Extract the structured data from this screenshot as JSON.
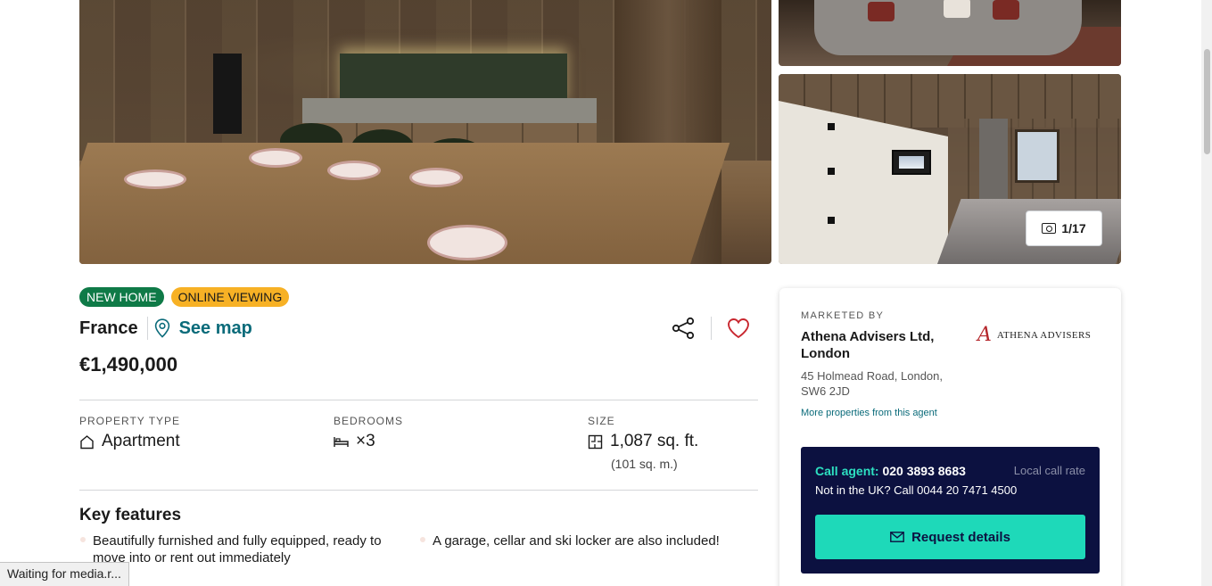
{
  "gallery": {
    "photo_counter": "1/17"
  },
  "listing": {
    "badges": [
      "NEW HOME",
      "ONLINE VIEWING"
    ],
    "country": "France",
    "see_map": "See map",
    "price": "€1,490,000"
  },
  "stats": {
    "property_type": {
      "label": "PROPERTY TYPE",
      "value": "Apartment"
    },
    "bedrooms": {
      "label": "BEDROOMS",
      "value": "×3"
    },
    "size": {
      "label": "SIZE",
      "value": "1,087 sq. ft.",
      "sub": "(101 sq. m.)"
    }
  },
  "key_features": {
    "title": "Key features",
    "items": [
      "Beautifully furnished and fully equipped, ready to move into or rent out immediately",
      "A garage, cellar and ski locker are also included!"
    ]
  },
  "agent": {
    "marketed_by": "MARKETED BY",
    "name": "Athena Advisers Ltd, London",
    "address": "45 Holmead Road, London, SW6 2JD",
    "more_link": "More properties from this agent",
    "logo_text": "ATHENA ADVISERS",
    "call_label": "Call agent:",
    "call_number": "020 3893 8683",
    "call_rate": "Local call rate",
    "intl_text": "Not in the UK? Call 0044 20 7471 4500",
    "request_button": "Request details"
  },
  "status_bar": "Waiting for media.r...",
  "colors": {
    "new_home_badge": "#0f7a47",
    "online_viewing_badge": "#f7b125",
    "link_teal": "#0b6b7a",
    "call_box_bg": "#0c1140",
    "request_button_bg": "#1ed9b9",
    "heart_red": "#c8262e"
  }
}
